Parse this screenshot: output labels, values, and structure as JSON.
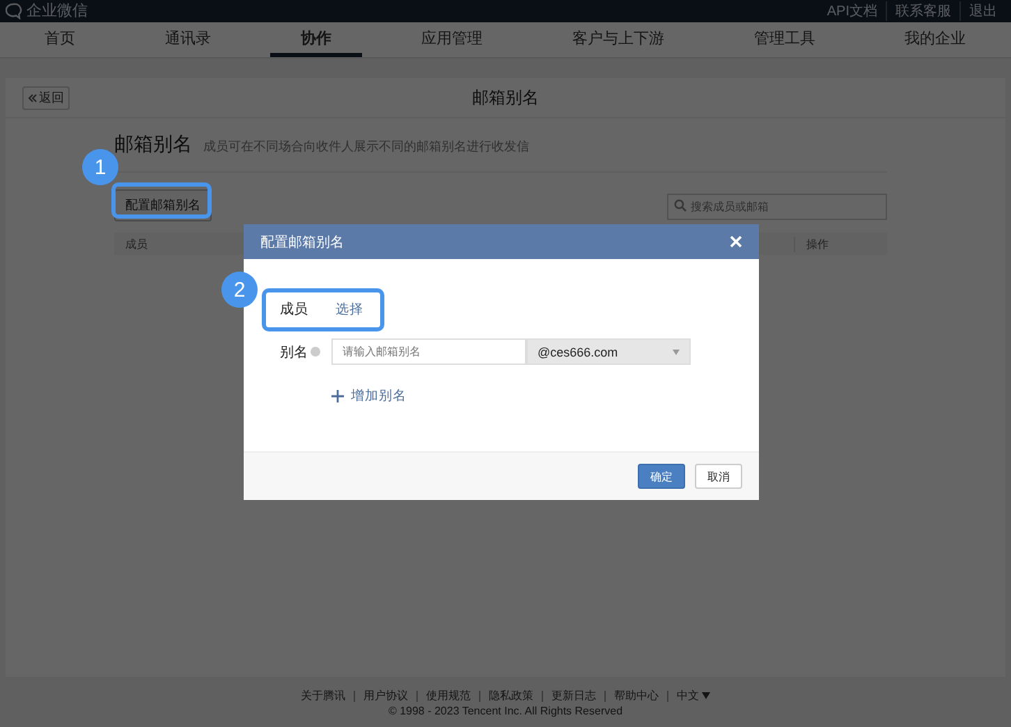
{
  "topbar": {
    "logo": "企业微信",
    "links": [
      "API文档",
      "联系客服",
      "退出"
    ]
  },
  "nav": [
    {
      "label": "首页",
      "selected": false
    },
    {
      "label": "通讯录",
      "selected": false
    },
    {
      "label": "协作",
      "selected": true
    },
    {
      "label": "应用管理",
      "selected": false
    },
    {
      "label": "客户与上下游",
      "selected": false
    },
    {
      "label": "管理工具",
      "selected": false
    },
    {
      "label": "我的企业",
      "selected": false
    }
  ],
  "page": {
    "back": "返回",
    "title": "邮箱别名",
    "heading": "邮箱别名",
    "description": "成员可在不同场合向收件人展示不同的邮箱别名进行收发信",
    "config_button": "配置邮箱别名",
    "search_placeholder": "搜索成员或邮箱",
    "columns": [
      "成员",
      "操作"
    ]
  },
  "dialog": {
    "title": "配置邮箱别名",
    "member_label": "成员",
    "select_link": "选择",
    "alias_label": "别名",
    "alias_placeholder": "请输入邮箱别名",
    "domain": "@ces666.com",
    "add_link": "增加别名",
    "buttons": [
      {
        "label": "确定",
        "kind": "primary"
      },
      {
        "label": "取消",
        "kind": "default"
      }
    ]
  },
  "annotations": [
    {
      "number": "1"
    },
    {
      "number": "2"
    }
  ],
  "footer": {
    "links": [
      "关于腾讯",
      "用户协议",
      "使用规范",
      "隐私政策",
      "更新日志",
      "帮助中心"
    ],
    "language": "中文",
    "copyright": "© 1998 - 2023 Tencent Inc. All Rights Reserved"
  }
}
